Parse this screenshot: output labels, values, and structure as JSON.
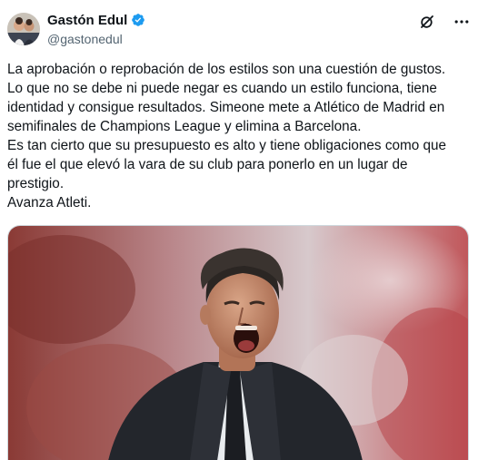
{
  "author": {
    "display_name": "Gastón Edul",
    "handle": "@gastonedul",
    "avatar_icon": "profile-photo",
    "verified_icon": "verified-badge-icon",
    "verified_color": "#1d9bf0"
  },
  "header_actions": {
    "grok_icon": "grok-icon",
    "more_icon": "more-options-icon"
  },
  "tweet": {
    "lines": [
      "La aprobación o reprobación de los estilos son una cuestión de gustos.",
      "Lo que no se debe ni puede negar es cuando un estilo funciona, tiene",
      "identidad y consigue resultados. Simeone mete a Atlético de Madrid en",
      "semifinales de Champions League y elimina a Barcelona.",
      "Es tan cierto que su presupuesto es alto y tiene obligaciones como que",
      "él fue el que elevó la vara de su club para ponerlo en un lugar de",
      "prestigio.",
      "Avanza Atleti."
    ]
  },
  "media": {
    "type": "photo",
    "subject": "man-shouting-photo"
  },
  "colors": {
    "text": "#0f1419",
    "secondary_text": "#536471",
    "accent": "#1d9bf0"
  }
}
